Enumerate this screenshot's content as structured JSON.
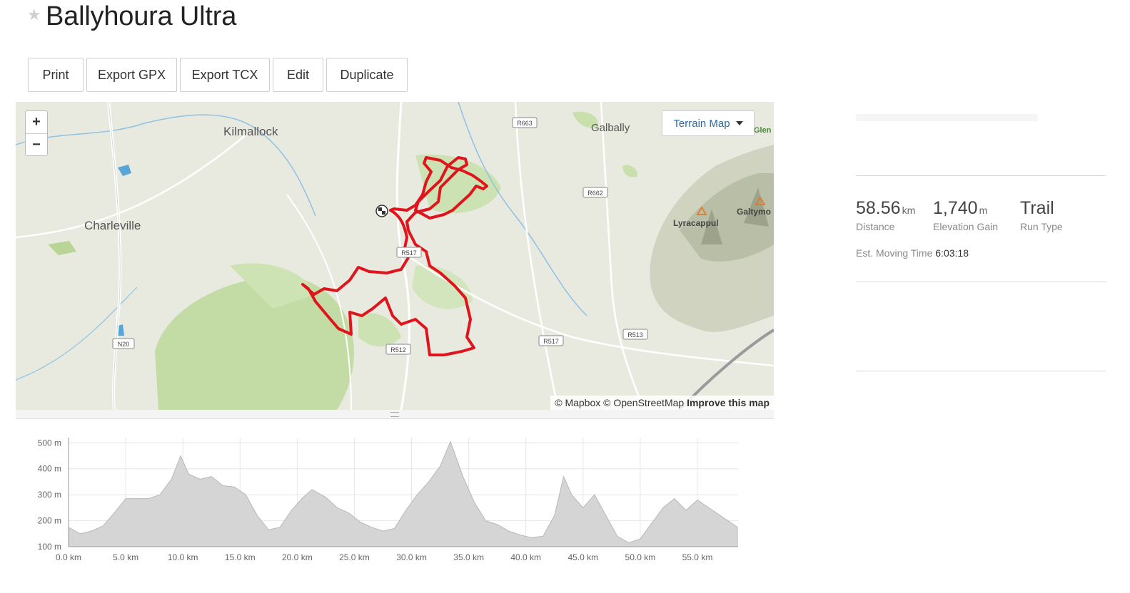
{
  "page": {
    "title": "Ballyhoura Ultra"
  },
  "toolbar": {
    "print": "Print",
    "export_gpx": "Export GPX",
    "export_tcx": "Export TCX",
    "edit": "Edit",
    "duplicate": "Duplicate"
  },
  "map": {
    "zoom_in": "+",
    "zoom_out": "−",
    "layer_select": "Terrain Map",
    "attribution": {
      "mapbox": "© Mapbox",
      "osm": "© OpenStreetMap",
      "improve": "Improve this map"
    },
    "labels": {
      "kilmallock": "Kilmallock",
      "charleville": "Charleville",
      "galbally": "Galbally",
      "lyracappul": "Lyracappul",
      "galtymore": "Galtymo",
      "glen": "Glen"
    },
    "roads": {
      "r663": "R663",
      "r662": "R662",
      "r517a": "R517",
      "r517b": "R517",
      "r513": "R513",
      "r512": "R512",
      "n20": "N20"
    },
    "colors": {
      "route": "#e0141c",
      "forest": "#b9d89a",
      "water": "#5aa5d8"
    }
  },
  "elevation": {
    "y_ticks": [
      "100 m",
      "200 m",
      "300 m",
      "400 m",
      "500 m"
    ],
    "x_ticks": [
      "0.0 km",
      "5.0 km",
      "10.0 km",
      "15.0 km",
      "20.0 km",
      "25.0 km",
      "30.0 km",
      "35.0 km",
      "40.0 km",
      "45.0 km",
      "50.0 km",
      "55.0 km"
    ],
    "profile_m": [
      {
        "km": 0,
        "m": 175
      },
      {
        "km": 1,
        "m": 150
      },
      {
        "km": 2,
        "m": 160
      },
      {
        "km": 3,
        "m": 180
      },
      {
        "km": 4,
        "m": 230
      },
      {
        "km": 5,
        "m": 285
      },
      {
        "km": 6,
        "m": 285
      },
      {
        "km": 7,
        "m": 285
      },
      {
        "km": 8,
        "m": 300
      },
      {
        "km": 9,
        "m": 360
      },
      {
        "km": 9.8,
        "m": 450
      },
      {
        "km": 10.5,
        "m": 380
      },
      {
        "km": 11.5,
        "m": 360
      },
      {
        "km": 12.5,
        "m": 370
      },
      {
        "km": 13.5,
        "m": 335
      },
      {
        "km": 14.5,
        "m": 330
      },
      {
        "km": 15.5,
        "m": 300
      },
      {
        "km": 16.5,
        "m": 220
      },
      {
        "km": 17.5,
        "m": 165
      },
      {
        "km": 18.5,
        "m": 175
      },
      {
        "km": 19.5,
        "m": 240
      },
      {
        "km": 20.5,
        "m": 290
      },
      {
        "km": 21.3,
        "m": 320
      },
      {
        "km": 22.5,
        "m": 290
      },
      {
        "km": 23.5,
        "m": 250
      },
      {
        "km": 24.5,
        "m": 230
      },
      {
        "km": 25.5,
        "m": 195
      },
      {
        "km": 26.5,
        "m": 175
      },
      {
        "km": 27.5,
        "m": 160
      },
      {
        "km": 28.5,
        "m": 170
      },
      {
        "km": 29.5,
        "m": 240
      },
      {
        "km": 30.5,
        "m": 300
      },
      {
        "km": 31.5,
        "m": 350
      },
      {
        "km": 32.5,
        "m": 410
      },
      {
        "km": 33.4,
        "m": 505
      },
      {
        "km": 34.5,
        "m": 370
      },
      {
        "km": 35.5,
        "m": 270
      },
      {
        "km": 36.5,
        "m": 200
      },
      {
        "km": 37.5,
        "m": 185
      },
      {
        "km": 38.5,
        "m": 160
      },
      {
        "km": 39.5,
        "m": 145
      },
      {
        "km": 40.5,
        "m": 135
      },
      {
        "km": 41.5,
        "m": 140
      },
      {
        "km": 42.5,
        "m": 220
      },
      {
        "km": 43.3,
        "m": 370
      },
      {
        "km": 44,
        "m": 300
      },
      {
        "km": 45,
        "m": 250
      },
      {
        "km": 46,
        "m": 300
      },
      {
        "km": 47,
        "m": 220
      },
      {
        "km": 48,
        "m": 140
      },
      {
        "km": 49,
        "m": 115
      },
      {
        "km": 50,
        "m": 130
      },
      {
        "km": 51,
        "m": 190
      },
      {
        "km": 52,
        "m": 250
      },
      {
        "km": 53,
        "m": 285
      },
      {
        "km": 54,
        "m": 240
      },
      {
        "km": 55,
        "m": 280
      },
      {
        "km": 56,
        "m": 250
      },
      {
        "km": 57,
        "m": 220
      },
      {
        "km": 58,
        "m": 190
      },
      {
        "km": 58.5,
        "m": 175
      }
    ],
    "y_range_m": [
      100,
      520
    ],
    "x_range_km": [
      0,
      58.56
    ],
    "fill": "#d5d5d5"
  },
  "stats": {
    "distance": {
      "value": "58.56",
      "unit": "km",
      "label": "Distance"
    },
    "elevation_gain": {
      "value": "1,740",
      "unit": "m",
      "label": "Elevation Gain"
    },
    "run_type": {
      "value": "Trail",
      "label": "Run Type"
    },
    "moving_time": {
      "label": "Est. Moving Time",
      "value": "6:03:18"
    }
  }
}
